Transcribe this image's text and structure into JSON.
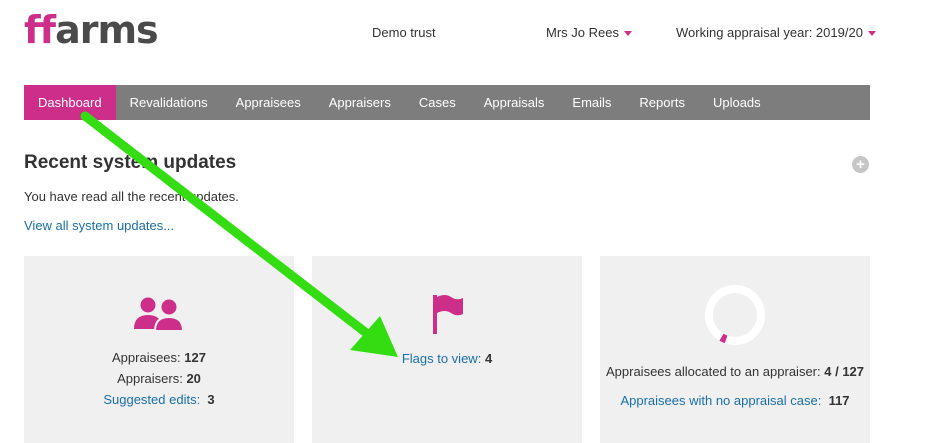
{
  "header": {
    "logo_ff": "ff",
    "logo_arms": "arms",
    "trust": "Demo trust",
    "user": "Mrs Jo Rees",
    "year": "Working appraisal year: 2019/20"
  },
  "nav": {
    "items": [
      {
        "label": "Dashboard",
        "active": true
      },
      {
        "label": "Revalidations"
      },
      {
        "label": "Appraisees"
      },
      {
        "label": "Appraisers"
      },
      {
        "label": "Cases"
      },
      {
        "label": "Appraisals"
      },
      {
        "label": "Emails"
      },
      {
        "label": "Reports"
      },
      {
        "label": "Uploads"
      }
    ]
  },
  "updates": {
    "title": "Recent system updates",
    "message": "You have read all the recent updates.",
    "view_all": "View all system updates..."
  },
  "cards": {
    "people": {
      "appraisees_label": "Appraisees:",
      "appraisees_value": "127",
      "appraisers_label": "Appraisers:",
      "appraisers_value": "20",
      "suggested_label": "Suggested edits:",
      "suggested_value": "3"
    },
    "flags": {
      "label": "Flags to view:",
      "value": "4"
    },
    "allocation": {
      "allocated_label": "Appraisees allocated to an appraiser:",
      "allocated_value": "4 / 127",
      "allocated_fraction": 0.0315,
      "no_case_label": "Appraisees with no appraisal case:",
      "no_case_value": "117"
    }
  },
  "colors": {
    "accent": "#cc2e8a",
    "nav_bg": "#7d7d7d",
    "link": "#1a6fa8",
    "card_bg": "#f0f0f0",
    "annotation_arrow": "#33dd11"
  },
  "icons": {
    "people": "people-icon",
    "flag": "flag-icon",
    "ring": "ring-progress-icon",
    "plus": "plus-circle-icon",
    "caret": "caret-down-icon"
  }
}
